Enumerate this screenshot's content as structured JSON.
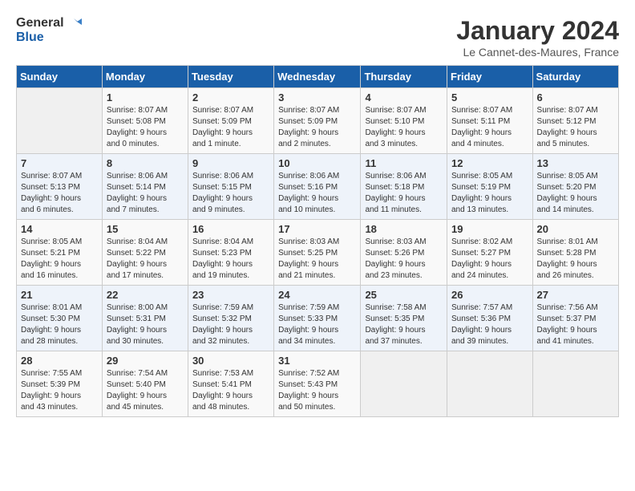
{
  "logo": {
    "text_general": "General",
    "text_blue": "Blue"
  },
  "header": {
    "month_title": "January 2024",
    "location": "Le Cannet-des-Maures, France"
  },
  "weekdays": [
    "Sunday",
    "Monday",
    "Tuesday",
    "Wednesday",
    "Thursday",
    "Friday",
    "Saturday"
  ],
  "weeks": [
    [
      {
        "day": "",
        "info": ""
      },
      {
        "day": "1",
        "info": "Sunrise: 8:07 AM\nSunset: 5:08 PM\nDaylight: 9 hours\nand 0 minutes."
      },
      {
        "day": "2",
        "info": "Sunrise: 8:07 AM\nSunset: 5:09 PM\nDaylight: 9 hours\nand 1 minute."
      },
      {
        "day": "3",
        "info": "Sunrise: 8:07 AM\nSunset: 5:09 PM\nDaylight: 9 hours\nand 2 minutes."
      },
      {
        "day": "4",
        "info": "Sunrise: 8:07 AM\nSunset: 5:10 PM\nDaylight: 9 hours\nand 3 minutes."
      },
      {
        "day": "5",
        "info": "Sunrise: 8:07 AM\nSunset: 5:11 PM\nDaylight: 9 hours\nand 4 minutes."
      },
      {
        "day": "6",
        "info": "Sunrise: 8:07 AM\nSunset: 5:12 PM\nDaylight: 9 hours\nand 5 minutes."
      }
    ],
    [
      {
        "day": "7",
        "info": "Sunrise: 8:07 AM\nSunset: 5:13 PM\nDaylight: 9 hours\nand 6 minutes."
      },
      {
        "day": "8",
        "info": "Sunrise: 8:06 AM\nSunset: 5:14 PM\nDaylight: 9 hours\nand 7 minutes."
      },
      {
        "day": "9",
        "info": "Sunrise: 8:06 AM\nSunset: 5:15 PM\nDaylight: 9 hours\nand 9 minutes."
      },
      {
        "day": "10",
        "info": "Sunrise: 8:06 AM\nSunset: 5:16 PM\nDaylight: 9 hours\nand 10 minutes."
      },
      {
        "day": "11",
        "info": "Sunrise: 8:06 AM\nSunset: 5:18 PM\nDaylight: 9 hours\nand 11 minutes."
      },
      {
        "day": "12",
        "info": "Sunrise: 8:05 AM\nSunset: 5:19 PM\nDaylight: 9 hours\nand 13 minutes."
      },
      {
        "day": "13",
        "info": "Sunrise: 8:05 AM\nSunset: 5:20 PM\nDaylight: 9 hours\nand 14 minutes."
      }
    ],
    [
      {
        "day": "14",
        "info": "Sunrise: 8:05 AM\nSunset: 5:21 PM\nDaylight: 9 hours\nand 16 minutes."
      },
      {
        "day": "15",
        "info": "Sunrise: 8:04 AM\nSunset: 5:22 PM\nDaylight: 9 hours\nand 17 minutes."
      },
      {
        "day": "16",
        "info": "Sunrise: 8:04 AM\nSunset: 5:23 PM\nDaylight: 9 hours\nand 19 minutes."
      },
      {
        "day": "17",
        "info": "Sunrise: 8:03 AM\nSunset: 5:25 PM\nDaylight: 9 hours\nand 21 minutes."
      },
      {
        "day": "18",
        "info": "Sunrise: 8:03 AM\nSunset: 5:26 PM\nDaylight: 9 hours\nand 23 minutes."
      },
      {
        "day": "19",
        "info": "Sunrise: 8:02 AM\nSunset: 5:27 PM\nDaylight: 9 hours\nand 24 minutes."
      },
      {
        "day": "20",
        "info": "Sunrise: 8:01 AM\nSunset: 5:28 PM\nDaylight: 9 hours\nand 26 minutes."
      }
    ],
    [
      {
        "day": "21",
        "info": "Sunrise: 8:01 AM\nSunset: 5:30 PM\nDaylight: 9 hours\nand 28 minutes."
      },
      {
        "day": "22",
        "info": "Sunrise: 8:00 AM\nSunset: 5:31 PM\nDaylight: 9 hours\nand 30 minutes."
      },
      {
        "day": "23",
        "info": "Sunrise: 7:59 AM\nSunset: 5:32 PM\nDaylight: 9 hours\nand 32 minutes."
      },
      {
        "day": "24",
        "info": "Sunrise: 7:59 AM\nSunset: 5:33 PM\nDaylight: 9 hours\nand 34 minutes."
      },
      {
        "day": "25",
        "info": "Sunrise: 7:58 AM\nSunset: 5:35 PM\nDaylight: 9 hours\nand 37 minutes."
      },
      {
        "day": "26",
        "info": "Sunrise: 7:57 AM\nSunset: 5:36 PM\nDaylight: 9 hours\nand 39 minutes."
      },
      {
        "day": "27",
        "info": "Sunrise: 7:56 AM\nSunset: 5:37 PM\nDaylight: 9 hours\nand 41 minutes."
      }
    ],
    [
      {
        "day": "28",
        "info": "Sunrise: 7:55 AM\nSunset: 5:39 PM\nDaylight: 9 hours\nand 43 minutes."
      },
      {
        "day": "29",
        "info": "Sunrise: 7:54 AM\nSunset: 5:40 PM\nDaylight: 9 hours\nand 45 minutes."
      },
      {
        "day": "30",
        "info": "Sunrise: 7:53 AM\nSunset: 5:41 PM\nDaylight: 9 hours\nand 48 minutes."
      },
      {
        "day": "31",
        "info": "Sunrise: 7:52 AM\nSunset: 5:43 PM\nDaylight: 9 hours\nand 50 minutes."
      },
      {
        "day": "",
        "info": ""
      },
      {
        "day": "",
        "info": ""
      },
      {
        "day": "",
        "info": ""
      }
    ]
  ]
}
